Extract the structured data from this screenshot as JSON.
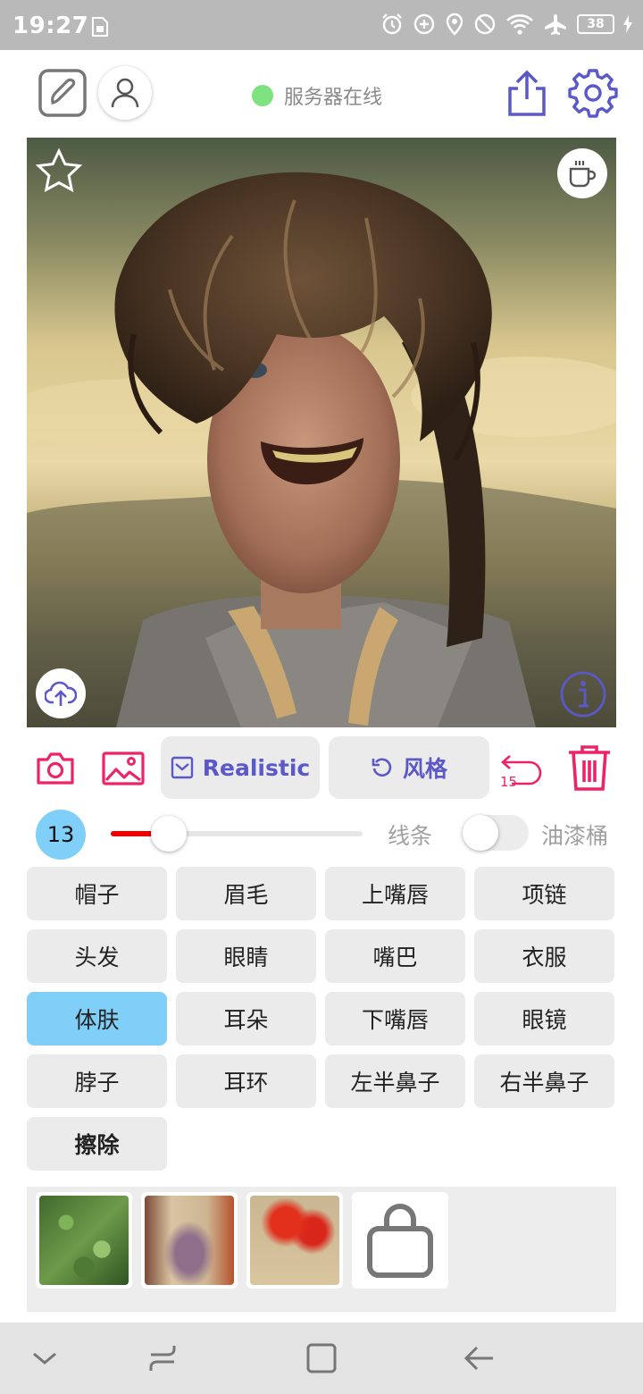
{
  "status_bar": {
    "time": "19:27",
    "battery": "38",
    "icons": [
      "sim-icon",
      "alarm-icon",
      "data-saver-icon",
      "location-icon",
      "dnd-icon",
      "wifi-icon",
      "airplane-icon",
      "battery-icon",
      "charging-icon"
    ]
  },
  "top_bar": {
    "server_status": "服务器在线",
    "server_status_color": "#7ee27e",
    "accent_color": "#5b58c8"
  },
  "toolbar": {
    "style_label": "Realistic",
    "style_button": "风格",
    "undo_count": "15",
    "accent_red": "#ee2266"
  },
  "brush": {
    "size": "13",
    "slider_value": 0.23,
    "line_label": "线条",
    "fill_label": "油漆桶",
    "fill_enabled": false
  },
  "parts": [
    {
      "label": "帽子"
    },
    {
      "label": "眉毛"
    },
    {
      "label": "上嘴唇"
    },
    {
      "label": "项链"
    },
    {
      "label": "头发"
    },
    {
      "label": "眼睛"
    },
    {
      "label": "嘴巴"
    },
    {
      "label": "衣服"
    },
    {
      "label": "体肤",
      "active": true
    },
    {
      "label": "耳朵"
    },
    {
      "label": "下嘴唇"
    },
    {
      "label": "眼镜"
    },
    {
      "label": "脖子"
    },
    {
      "label": "耳环"
    },
    {
      "label": "左半鼻子"
    },
    {
      "label": "右半鼻子"
    },
    {
      "label": "擦除"
    }
  ],
  "styles": [
    {
      "name": "green-foliage-thumbnail"
    },
    {
      "name": "beige-lavender-thumbnail"
    },
    {
      "name": "red-flowers-thumbnail"
    }
  ]
}
